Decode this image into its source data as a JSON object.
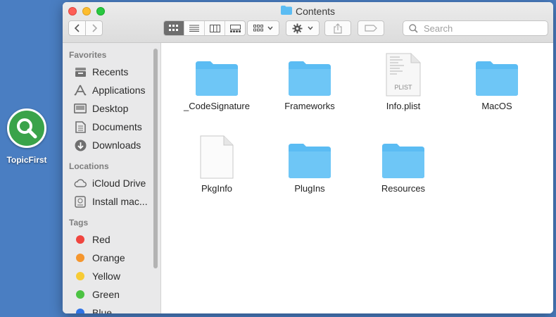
{
  "desktop": {
    "app_label": "TopicFirst"
  },
  "window": {
    "title": "Contents",
    "search_placeholder": "Search"
  },
  "sidebar": {
    "favorites_header": "Favorites",
    "favorites": [
      {
        "label": "Recents",
        "icon": "recents-icon"
      },
      {
        "label": "Applications",
        "icon": "applications-icon"
      },
      {
        "label": "Desktop",
        "icon": "desktop-icon"
      },
      {
        "label": "Documents",
        "icon": "documents-icon"
      },
      {
        "label": "Downloads",
        "icon": "downloads-icon"
      }
    ],
    "locations_header": "Locations",
    "locations": [
      {
        "label": "iCloud Drive",
        "icon": "cloud-icon"
      },
      {
        "label": "Install mac...",
        "icon": "disk-icon"
      }
    ],
    "tags_header": "Tags",
    "tags": [
      {
        "label": "Red",
        "color": "#f0453f"
      },
      {
        "label": "Orange",
        "color": "#f5962e"
      },
      {
        "label": "Yellow",
        "color": "#f7cb35"
      },
      {
        "label": "Green",
        "color": "#4cc343"
      },
      {
        "label": "Blue",
        "color": "#2f73e6"
      }
    ]
  },
  "files": [
    {
      "name": "_CodeSignature",
      "kind": "folder"
    },
    {
      "name": "Frameworks",
      "kind": "folder"
    },
    {
      "name": "Info.plist",
      "kind": "plist",
      "badge": "PLIST"
    },
    {
      "name": "MacOS",
      "kind": "folder"
    },
    {
      "name": "PkgInfo",
      "kind": "document"
    },
    {
      "name": "PlugIns",
      "kind": "folder"
    },
    {
      "name": "Resources",
      "kind": "folder"
    }
  ],
  "colors": {
    "folder": "#5bbcf3",
    "desktop_bg": "#4a7ec2",
    "app_icon": "#3aa34a"
  }
}
